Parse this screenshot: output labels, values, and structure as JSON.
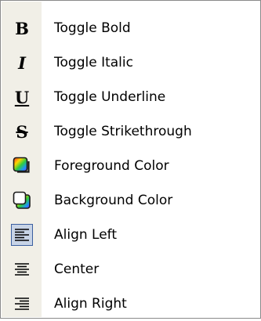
{
  "menu": {
    "items": [
      {
        "label": "Toggle Bold",
        "icon": "bold-icon",
        "glyph": "B",
        "checked": false
      },
      {
        "label": "Toggle Italic",
        "icon": "italic-icon",
        "glyph": "I",
        "checked": false
      },
      {
        "label": "Toggle Underline",
        "icon": "underline-icon",
        "glyph": "U",
        "checked": false
      },
      {
        "label": "Toggle Strikethrough",
        "icon": "strikethrough-icon",
        "glyph": "S",
        "checked": false
      },
      {
        "label": "Foreground Color",
        "icon": "foreground-color-icon",
        "checked": false
      },
      {
        "label": "Background Color",
        "icon": "background-color-icon",
        "checked": false
      },
      {
        "label": "Align Left",
        "icon": "align-left-icon",
        "checked": true
      },
      {
        "label": "Center",
        "icon": "align-center-icon",
        "checked": false
      },
      {
        "label": "Align Right",
        "icon": "align-right-icon",
        "checked": false
      }
    ]
  },
  "colors": {
    "gutter": "#f1efe7",
    "checked_fill": "#c7d3e6",
    "checked_border": "#3b5fa0"
  }
}
